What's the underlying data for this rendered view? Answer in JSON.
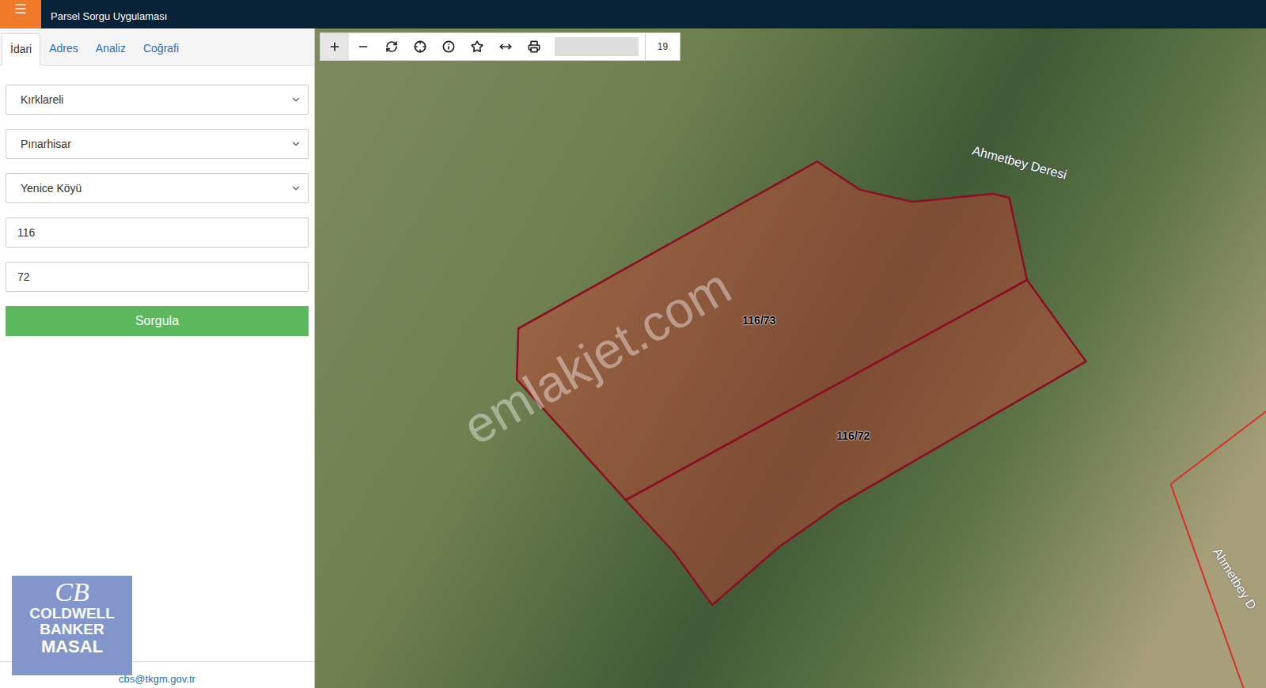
{
  "app": {
    "title": "Parsel Sorgu Uygulaması"
  },
  "tabs": [
    {
      "label": "İdari",
      "selected": true
    },
    {
      "label": "Adres",
      "selected": false
    },
    {
      "label": "Analiz",
      "selected": false
    },
    {
      "label": "Coğrafi",
      "selected": false
    }
  ],
  "form": {
    "selects": [
      "Kırklareli",
      "Pınarhisar",
      "Yenice Köyü"
    ],
    "inputs": [
      "116",
      "72"
    ],
    "button": "Sorgula"
  },
  "footer": {
    "email": "cbs@tkgm.gov.tr"
  },
  "logo": {
    "mark": "CB",
    "lines": [
      "COLDWELL",
      "BANKER",
      "MASAL"
    ]
  },
  "toolbar": {
    "zoom": "19"
  },
  "map": {
    "parcels": [
      {
        "label": "116/73"
      },
      {
        "label": "116/72"
      }
    ],
    "labels": [
      "Ahmetbey Deresi",
      "Ahmetbey D"
    ],
    "watermark": "emlakjet.com"
  }
}
